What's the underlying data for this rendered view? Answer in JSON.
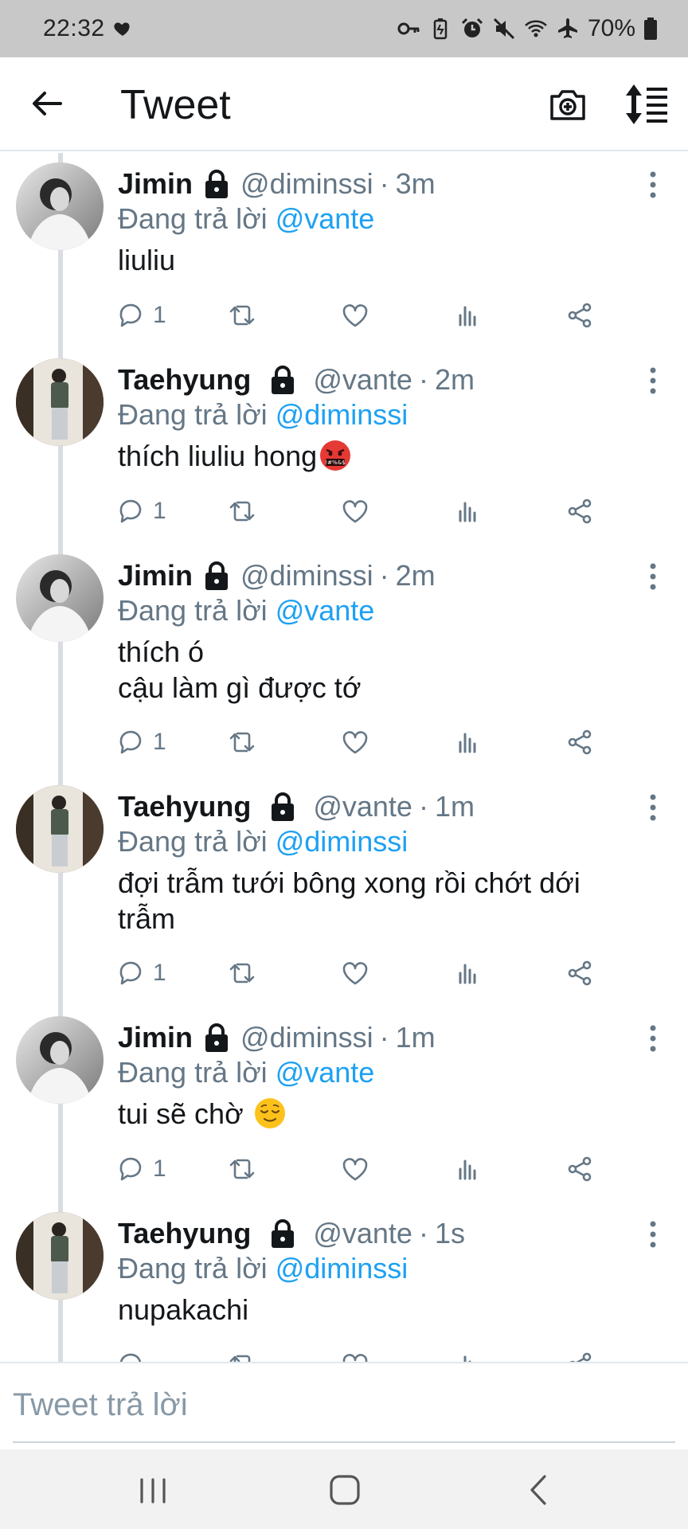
{
  "status_bar": {
    "time": "22:32",
    "battery": "70%",
    "icons": [
      "heart-icon",
      "key-icon",
      "battery-saver-icon",
      "alarm-icon",
      "mute-icon",
      "wifi-icon",
      "airplane-icon",
      "battery-icon"
    ]
  },
  "app_bar": {
    "title": "Tweet",
    "back_icon": "arrow-left-icon",
    "camera_icon": "camera-plus-icon",
    "sort_icon": "sort-icon"
  },
  "colors": {
    "mention": "#1da1f2",
    "muted": "#657786",
    "text": "#14171a",
    "status_bar_bg": "#c8c8c8"
  },
  "tweets": [
    {
      "name": "Jimin",
      "handle": "@diminssi",
      "separator": "·",
      "time": "3m",
      "replying_prefix": "Đang trả lời",
      "replying_to": "@vante",
      "text": "liuliu",
      "text_line_2": "",
      "emoji": "",
      "reply_count": "1"
    },
    {
      "name": "Taehyung",
      "handle": "@vante",
      "separator": "·",
      "time": "2m",
      "replying_prefix": "Đang trả lời",
      "replying_to": "@diminssi",
      "text": "thích liuliu hong",
      "text_line_2": "",
      "emoji": "face-with-symbols-on-mouth",
      "reply_count": "1"
    },
    {
      "name": "Jimin",
      "handle": "@diminssi",
      "separator": "·",
      "time": "2m",
      "replying_prefix": "Đang trả lời",
      "replying_to": "@vante",
      "text": "thích ó",
      "text_line_2": "cậu làm gì được tớ",
      "emoji": "",
      "reply_count": "1"
    },
    {
      "name": "Taehyung",
      "handle": "@vante",
      "separator": "·",
      "time": "1m",
      "replying_prefix": "Đang trả lời",
      "replying_to": "@diminssi",
      "text": "đợi trẫm tưới bông xong rồi chớt dới",
      "text_line_2": "trẫm",
      "emoji": "",
      "reply_count": "1"
    },
    {
      "name": "Jimin",
      "handle": "@diminssi",
      "separator": "·",
      "time": "1m",
      "replying_prefix": "Đang trả lời",
      "replying_to": "@vante",
      "text": "tui sẽ chờ",
      "text_line_2": "",
      "emoji": "relieved-face",
      "reply_count": "1"
    },
    {
      "name": "Taehyung",
      "handle": "@vante",
      "separator": "·",
      "time": "1s",
      "replying_prefix": "Đang trả lời",
      "replying_to": "@diminssi",
      "text": "nupakachi",
      "text_line_2": "",
      "emoji": "",
      "reply_count": ""
    }
  ],
  "composer": {
    "placeholder": "Tweet trả lời"
  },
  "nav_bar": {
    "icons": [
      "recent-apps-icon",
      "home-icon",
      "back-icon"
    ]
  }
}
